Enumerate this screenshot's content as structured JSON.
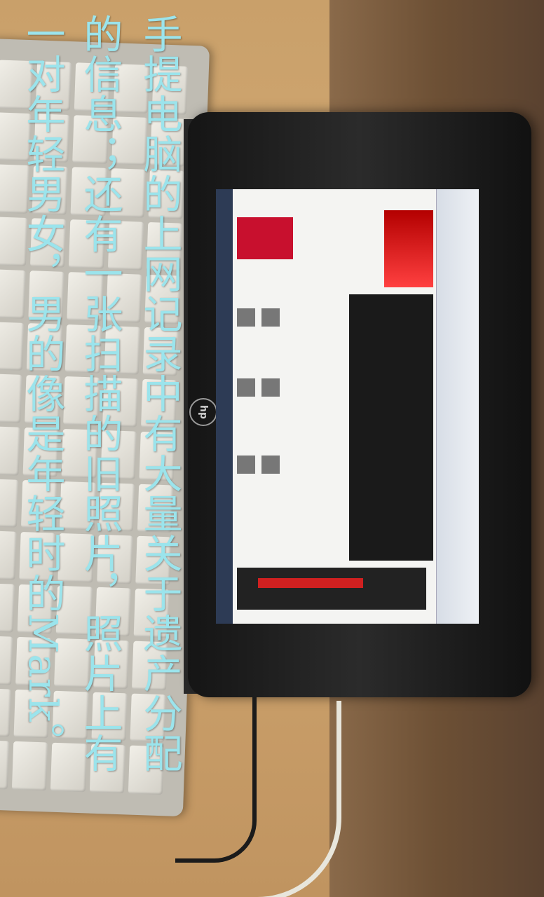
{
  "photo": {
    "subject": "HP netbook screen and keyboard",
    "logo_text": "hp"
  },
  "caption": {
    "lines": [
      "手提电脑的上网记录中有大量关于遗产分配",
      "的信息；还有一张扫描的旧照片，照片上有",
      "一对年轻男女，男的像是年轻时的Mark。"
    ],
    "color": "#9be4ec"
  }
}
